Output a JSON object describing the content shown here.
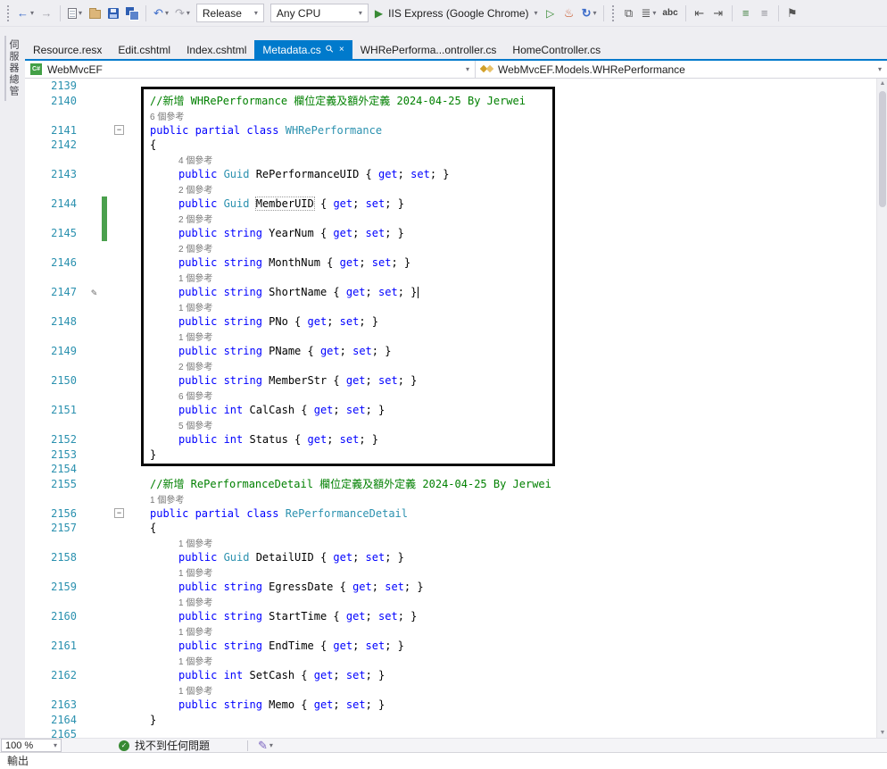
{
  "toolbar": {
    "config": "Release",
    "platform": "Any CPU",
    "run_label": "IIS Express (Google Chrome)",
    "word_completion_label": "abc"
  },
  "side_tab_label": "伺服器總管",
  "tabs": [
    {
      "label": "Resource.resx",
      "active": false
    },
    {
      "label": "Edit.cshtml",
      "active": false
    },
    {
      "label": "Index.cshtml",
      "active": false
    },
    {
      "label": "Metadata.cs",
      "active": true
    },
    {
      "label": "WHRePerforma...ontroller.cs",
      "active": false
    },
    {
      "label": "HomeController.cs",
      "active": false
    }
  ],
  "navbar": {
    "project": "WebMvcEF",
    "member": "WebMvcEF.Models.WHRePerformance"
  },
  "statusbar": {
    "zoom": "100 %",
    "health": "找不到任何問題"
  },
  "output": {
    "title": "輸出"
  },
  "editor": {
    "rows": [
      {
        "n": "2139",
        "i": 0,
        "t": []
      },
      {
        "n": "2140",
        "i": 1,
        "t": [
          [
            "c",
            "//新增 WHRePerformance 欄位定義及額外定義 2024-04-25 By Jerwei"
          ]
        ]
      },
      {
        "n": "",
        "i": 1,
        "t": [
          [
            "l",
            "6 個參考"
          ]
        ]
      },
      {
        "n": "2141",
        "i": 1,
        "f": 1,
        "t": [
          [
            "k",
            "public partial class "
          ],
          [
            "y",
            "WHRePerformance"
          ]
        ]
      },
      {
        "n": "2142",
        "i": 1,
        "t": [
          [
            "p",
            "{"
          ]
        ]
      },
      {
        "n": "",
        "i": 2,
        "t": [
          [
            "l",
            "4 個參考"
          ]
        ]
      },
      {
        "n": "2143",
        "i": 2,
        "t": [
          [
            "k",
            "public "
          ],
          [
            "y",
            "Guid"
          ],
          [
            "p",
            " RePerformanceUID { "
          ],
          [
            "k",
            "get"
          ],
          [
            "p",
            "; "
          ],
          [
            "k",
            "set"
          ],
          [
            "p",
            "; }"
          ]
        ]
      },
      {
        "n": "",
        "i": 2,
        "t": [
          [
            "l",
            "2 個參考"
          ]
        ]
      },
      {
        "n": "2144",
        "i": 2,
        "ch": 1,
        "t": [
          [
            "k",
            "public "
          ],
          [
            "y",
            "Guid"
          ],
          [
            "p",
            " "
          ],
          [
            "b",
            "MemberUID"
          ],
          [
            "p",
            " { "
          ],
          [
            "k",
            "get"
          ],
          [
            "p",
            "; "
          ],
          [
            "k",
            "set"
          ],
          [
            "p",
            "; }"
          ]
        ]
      },
      {
        "n": "",
        "i": 2,
        "ch": 1,
        "t": [
          [
            "l",
            "2 個參考"
          ]
        ]
      },
      {
        "n": "2145",
        "i": 2,
        "ch": 1,
        "t": [
          [
            "k",
            "public string "
          ],
          [
            "p",
            "YearNum { "
          ],
          [
            "k",
            "get"
          ],
          [
            "p",
            "; "
          ],
          [
            "k",
            "set"
          ],
          [
            "p",
            "; }"
          ]
        ]
      },
      {
        "n": "",
        "i": 2,
        "t": [
          [
            "l",
            "2 個參考"
          ]
        ]
      },
      {
        "n": "2146",
        "i": 2,
        "t": [
          [
            "k",
            "public string "
          ],
          [
            "p",
            "MonthNum { "
          ],
          [
            "k",
            "get"
          ],
          [
            "p",
            "; "
          ],
          [
            "k",
            "set"
          ],
          [
            "p",
            "; }"
          ]
        ]
      },
      {
        "n": "",
        "i": 2,
        "t": [
          [
            "l",
            "1 個參考"
          ]
        ]
      },
      {
        "n": "2147",
        "i": 2,
        "pencil": 1,
        "caret": 1,
        "t": [
          [
            "k",
            "public string "
          ],
          [
            "p",
            "ShortName { "
          ],
          [
            "k",
            "get"
          ],
          [
            "p",
            "; "
          ],
          [
            "k",
            "set"
          ],
          [
            "p",
            "; }"
          ]
        ]
      },
      {
        "n": "",
        "i": 2,
        "t": [
          [
            "l",
            "1 個參考"
          ]
        ]
      },
      {
        "n": "2148",
        "i": 2,
        "t": [
          [
            "k",
            "public string "
          ],
          [
            "p",
            "PNo { "
          ],
          [
            "k",
            "get"
          ],
          [
            "p",
            "; "
          ],
          [
            "k",
            "set"
          ],
          [
            "p",
            "; }"
          ]
        ]
      },
      {
        "n": "",
        "i": 2,
        "t": [
          [
            "l",
            "1 個參考"
          ]
        ]
      },
      {
        "n": "2149",
        "i": 2,
        "t": [
          [
            "k",
            "public string "
          ],
          [
            "p",
            "PName { "
          ],
          [
            "k",
            "get"
          ],
          [
            "p",
            "; "
          ],
          [
            "k",
            "set"
          ],
          [
            "p",
            "; }"
          ]
        ]
      },
      {
        "n": "",
        "i": 2,
        "t": [
          [
            "l",
            "2 個參考"
          ]
        ]
      },
      {
        "n": "2150",
        "i": 2,
        "t": [
          [
            "k",
            "public string "
          ],
          [
            "p",
            "MemberStr { "
          ],
          [
            "k",
            "get"
          ],
          [
            "p",
            "; "
          ],
          [
            "k",
            "set"
          ],
          [
            "p",
            "; }"
          ]
        ]
      },
      {
        "n": "",
        "i": 2,
        "t": [
          [
            "l",
            "6 個參考"
          ]
        ]
      },
      {
        "n": "2151",
        "i": 2,
        "t": [
          [
            "k",
            "public int "
          ],
          [
            "p",
            "CalCash { "
          ],
          [
            "k",
            "get"
          ],
          [
            "p",
            "; "
          ],
          [
            "k",
            "set"
          ],
          [
            "p",
            "; }"
          ]
        ]
      },
      {
        "n": "",
        "i": 2,
        "t": [
          [
            "l",
            "5 個參考"
          ]
        ]
      },
      {
        "n": "2152",
        "i": 2,
        "t": [
          [
            "k",
            "public int "
          ],
          [
            "p",
            "Status { "
          ],
          [
            "k",
            "get"
          ],
          [
            "p",
            "; "
          ],
          [
            "k",
            "set"
          ],
          [
            "p",
            "; }"
          ]
        ]
      },
      {
        "n": "2153",
        "i": 1,
        "t": [
          [
            "p",
            "}"
          ]
        ]
      },
      {
        "n": "2154",
        "i": 0,
        "t": []
      },
      {
        "n": "2155",
        "i": 1,
        "t": [
          [
            "c",
            "//新增 RePerformanceDetail 欄位定義及額外定義 2024-04-25 By Jerwei"
          ]
        ]
      },
      {
        "n": "",
        "i": 1,
        "t": [
          [
            "l",
            "1 個參考"
          ]
        ]
      },
      {
        "n": "2156",
        "i": 1,
        "f": 1,
        "t": [
          [
            "k",
            "public partial class "
          ],
          [
            "y",
            "RePerformanceDetail"
          ]
        ]
      },
      {
        "n": "2157",
        "i": 1,
        "t": [
          [
            "p",
            "{"
          ]
        ]
      },
      {
        "n": "",
        "i": 2,
        "t": [
          [
            "l",
            "1 個參考"
          ]
        ]
      },
      {
        "n": "2158",
        "i": 2,
        "t": [
          [
            "k",
            "public "
          ],
          [
            "y",
            "Guid"
          ],
          [
            "p",
            " DetailUID { "
          ],
          [
            "k",
            "get"
          ],
          [
            "p",
            "; "
          ],
          [
            "k",
            "set"
          ],
          [
            "p",
            "; }"
          ]
        ]
      },
      {
        "n": "",
        "i": 2,
        "t": [
          [
            "l",
            "1 個參考"
          ]
        ]
      },
      {
        "n": "2159",
        "i": 2,
        "t": [
          [
            "k",
            "public string "
          ],
          [
            "p",
            "EgressDate { "
          ],
          [
            "k",
            "get"
          ],
          [
            "p",
            "; "
          ],
          [
            "k",
            "set"
          ],
          [
            "p",
            "; }"
          ]
        ]
      },
      {
        "n": "",
        "i": 2,
        "t": [
          [
            "l",
            "1 個參考"
          ]
        ]
      },
      {
        "n": "2160",
        "i": 2,
        "t": [
          [
            "k",
            "public string "
          ],
          [
            "p",
            "StartTime { "
          ],
          [
            "k",
            "get"
          ],
          [
            "p",
            "; "
          ],
          [
            "k",
            "set"
          ],
          [
            "p",
            "; }"
          ]
        ]
      },
      {
        "n": "",
        "i": 2,
        "t": [
          [
            "l",
            "1 個參考"
          ]
        ]
      },
      {
        "n": "2161",
        "i": 2,
        "t": [
          [
            "k",
            "public string "
          ],
          [
            "p",
            "EndTime { "
          ],
          [
            "k",
            "get"
          ],
          [
            "p",
            "; "
          ],
          [
            "k",
            "set"
          ],
          [
            "p",
            "; }"
          ]
        ]
      },
      {
        "n": "",
        "i": 2,
        "t": [
          [
            "l",
            "1 個參考"
          ]
        ]
      },
      {
        "n": "2162",
        "i": 2,
        "t": [
          [
            "k",
            "public int "
          ],
          [
            "p",
            "SetCash { "
          ],
          [
            "k",
            "get"
          ],
          [
            "p",
            "; "
          ],
          [
            "k",
            "set"
          ],
          [
            "p",
            "; }"
          ]
        ]
      },
      {
        "n": "",
        "i": 2,
        "t": [
          [
            "l",
            "1 個參考"
          ]
        ]
      },
      {
        "n": "2163",
        "i": 2,
        "t": [
          [
            "k",
            "public string "
          ],
          [
            "p",
            "Memo { "
          ],
          [
            "k",
            "get"
          ],
          [
            "p",
            "; "
          ],
          [
            "k",
            "set"
          ],
          [
            "p",
            "; }"
          ]
        ]
      },
      {
        "n": "2164",
        "i": 1,
        "t": [
          [
            "p",
            "}"
          ]
        ]
      },
      {
        "n": "2165",
        "i": 0,
        "t": []
      }
    ]
  }
}
